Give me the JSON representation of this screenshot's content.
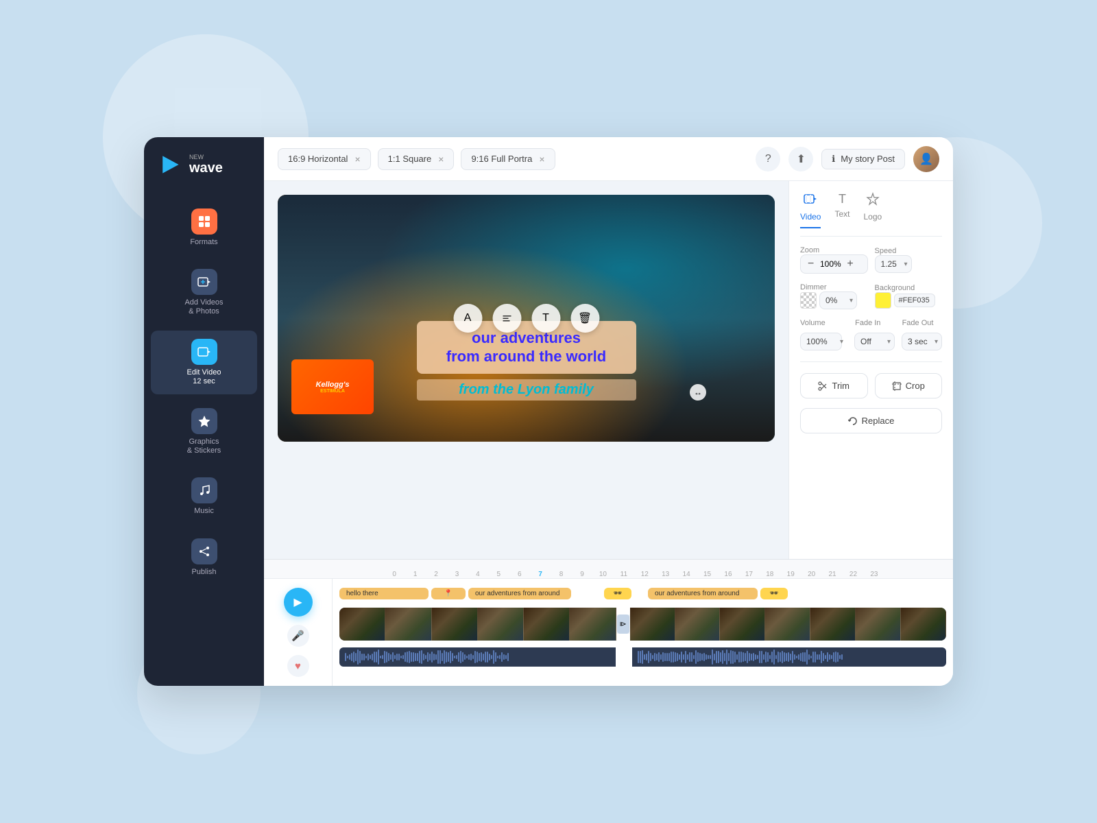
{
  "app": {
    "name": "wave",
    "name_new": "NEW"
  },
  "tabs": [
    {
      "label": "16:9 Horizontal",
      "id": "tab-16-9"
    },
    {
      "label": "1:1 Square",
      "id": "tab-1-1"
    },
    {
      "label": "9:16 Full Portra",
      "id": "tab-9-16"
    }
  ],
  "project": {
    "title": "My story Post"
  },
  "sidebar": {
    "items": [
      {
        "label": "Formats",
        "id": "formats"
      },
      {
        "label": "Add Videos\n& Photos",
        "id": "add-videos"
      },
      {
        "label": "Edit Video\n12 sec",
        "id": "edit-video"
      },
      {
        "label": "Graphics\n& Stickers",
        "id": "graphics-stickers"
      },
      {
        "label": "Music",
        "id": "music"
      },
      {
        "label": "Publish",
        "id": "publish"
      }
    ]
  },
  "panel": {
    "tabs": [
      {
        "label": "Video",
        "id": "video"
      },
      {
        "label": "Text",
        "id": "text"
      },
      {
        "label": "Logo",
        "id": "logo"
      }
    ],
    "zoom": {
      "label": "Zoom",
      "value": "100%"
    },
    "speed": {
      "label": "Speed",
      "value": "1.25"
    },
    "dimmer": {
      "label": "Dimmer",
      "value": "0%"
    },
    "background": {
      "label": "Background",
      "color": "#FEF035",
      "hex": "#FEF035"
    },
    "volume": {
      "label": "Volume",
      "value": "100%"
    },
    "fade_in": {
      "label": "Fade In",
      "value": "Off"
    },
    "fade_out": {
      "label": "Fade Out",
      "value": "3 sec"
    },
    "trim_label": "Trim",
    "crop_label": "Crop",
    "replace_label": "Replace"
  },
  "video": {
    "overlay_text_line1": "our adventures",
    "overlay_text_line2": "from around the world",
    "overlay_text_line3": "from the Lyon family"
  },
  "timeline": {
    "play_label": "▶",
    "markers": [
      "0",
      "1",
      "2",
      "3",
      "4",
      "5",
      "6",
      "7",
      "8",
      "9",
      "10",
      "11",
      "12",
      "13",
      "14",
      "15",
      "16",
      "17",
      "18",
      "19",
      "20",
      "21",
      "22",
      "23"
    ],
    "text_chips": [
      {
        "label": "hello there",
        "type": "text"
      },
      {
        "label": "our adventures from around",
        "type": "text"
      },
      {
        "label": "🕶",
        "type": "emoji"
      },
      {
        "label": "our adventures from around",
        "type": "text"
      },
      {
        "label": "🕶",
        "type": "emoji"
      }
    ]
  }
}
